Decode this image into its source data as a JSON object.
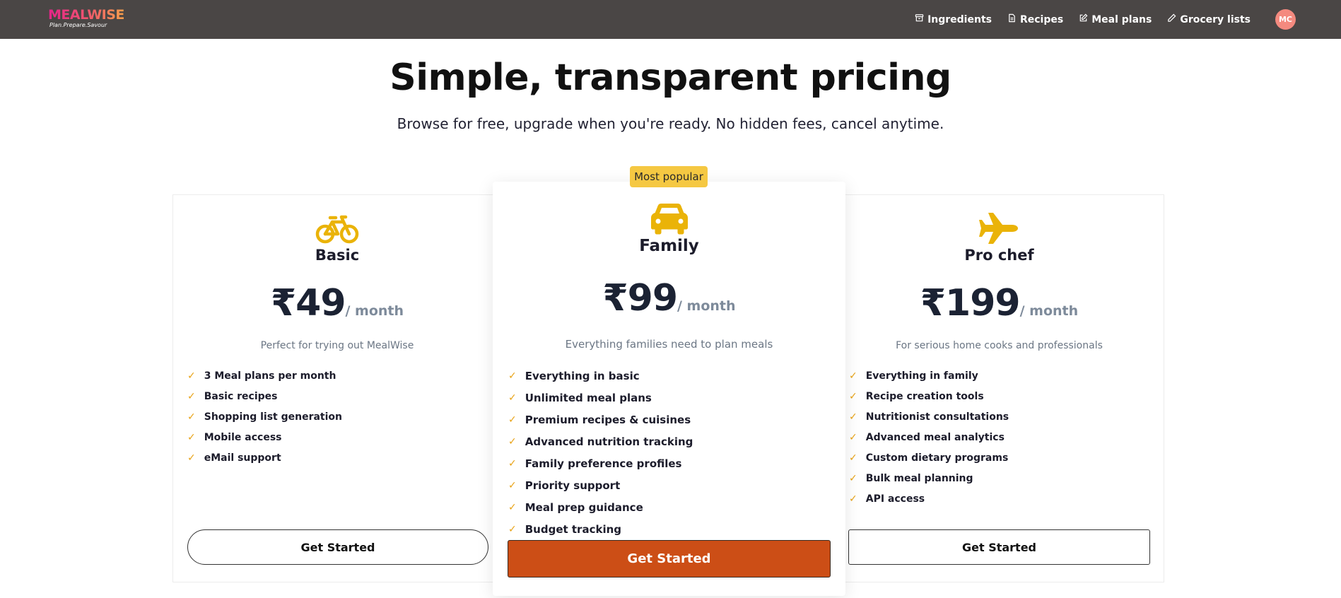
{
  "nav": {
    "logo_main": "MEALWISE",
    "logo_sub": "Plan.Prepare.Savour",
    "links": [
      {
        "label": "Ingredients",
        "icon": "basket-icon"
      },
      {
        "label": "Recipes",
        "icon": "document-icon"
      },
      {
        "label": "Meal plans",
        "icon": "edit-icon"
      },
      {
        "label": "Grocery lists",
        "icon": "pencil-icon"
      }
    ],
    "avatar": "MC"
  },
  "header": {
    "title": "Simple, transparent pricing",
    "subtitle": "Browse for free, upgrade when you're ready. No hidden fees, cancel anytime."
  },
  "colors": {
    "accent": "#cc4e16",
    "icon": "#eab308",
    "badge": "#f5c842",
    "nav_bg": "#4a4645"
  },
  "plans": {
    "basic": {
      "icon": "bicycle-icon",
      "name": "Basic",
      "price": "₹49",
      "period": "/ month",
      "tagline": "Perfect for trying out MealWise",
      "features": [
        "3 Meal plans per month",
        "Basic recipes",
        "Shopping list generation",
        "Mobile access",
        "eMail support"
      ],
      "cta": "Get Started"
    },
    "family": {
      "badge": "Most popular",
      "icon": "car-icon",
      "name": "Family",
      "price": "₹99",
      "period": "/ month",
      "tagline": "Everything families need to plan meals",
      "features": [
        "Everything in basic",
        "Unlimited meal plans",
        "Premium recipes & cuisines",
        "Advanced nutrition tracking",
        "Family preference profiles",
        "Priority support",
        "Meal prep guidance",
        "Budget tracking"
      ],
      "cta": "Get Started"
    },
    "pro": {
      "icon": "airplane-icon",
      "name": "Pro chef",
      "price": "₹199",
      "period": "/ month",
      "tagline": "For serious home cooks and professionals",
      "features": [
        "Everything in family",
        "Recipe creation tools",
        "Nutritionist consultations",
        "Advanced meal analytics",
        "Custom dietary programs",
        "Bulk meal planning",
        "API access"
      ],
      "cta": "Get Started"
    }
  }
}
